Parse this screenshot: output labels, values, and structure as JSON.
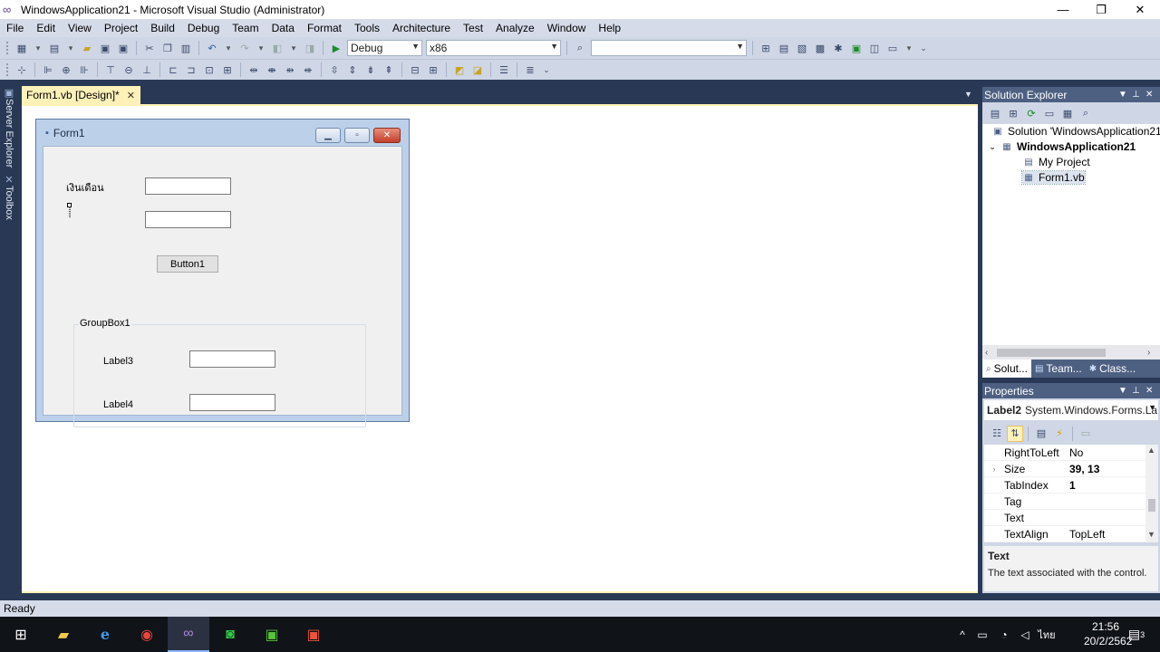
{
  "window": {
    "title": "WindowsApplication21 - Microsoft Visual Studio (Administrator)",
    "min": "—",
    "max": "❐",
    "close": "✕"
  },
  "menu": [
    "File",
    "Edit",
    "View",
    "Project",
    "Build",
    "Debug",
    "Team",
    "Data",
    "Format",
    "Tools",
    "Architecture",
    "Test",
    "Analyze",
    "Window",
    "Help"
  ],
  "toolbar": {
    "config": "Debug",
    "platform": "x86",
    "find": ""
  },
  "leftrail": {
    "server_explorer": "Server Explorer",
    "toolbox": "Toolbox"
  },
  "doc_tab": {
    "label": "Form1.vb [Design]*",
    "close": "✕"
  },
  "form": {
    "title": "Form1",
    "label1": "เงินเดือน",
    "button1": "Button1",
    "groupbox": "GroupBox1",
    "label3": "Label3",
    "label4": "Label4"
  },
  "solution_explorer": {
    "title": "Solution Explorer",
    "solution": "Solution 'WindowsApplication21",
    "project": "WindowsApplication21",
    "my_project": "My Project",
    "file": "Form1.vb",
    "tabs": [
      "Solut...",
      "Team...",
      "Class..."
    ]
  },
  "properties": {
    "title": "Properties",
    "object_name": "Label2",
    "object_type": "System.Windows.Forms.La",
    "rows": [
      {
        "name": "RightToLeft",
        "value": "No"
      },
      {
        "name": "Size",
        "value": "39, 13"
      },
      {
        "name": "TabIndex",
        "value": "1"
      },
      {
        "name": "Tag",
        "value": ""
      },
      {
        "name": "Text",
        "value": ""
      },
      {
        "name": "TextAlign",
        "value": "TopLeft"
      }
    ],
    "desc_title": "Text",
    "desc_text": "The text associated with the control."
  },
  "status": "Ready",
  "taskbar": {
    "ime": "ไทย",
    "time": "21:56",
    "date": "20/2/2562",
    "notify_count": "3"
  }
}
